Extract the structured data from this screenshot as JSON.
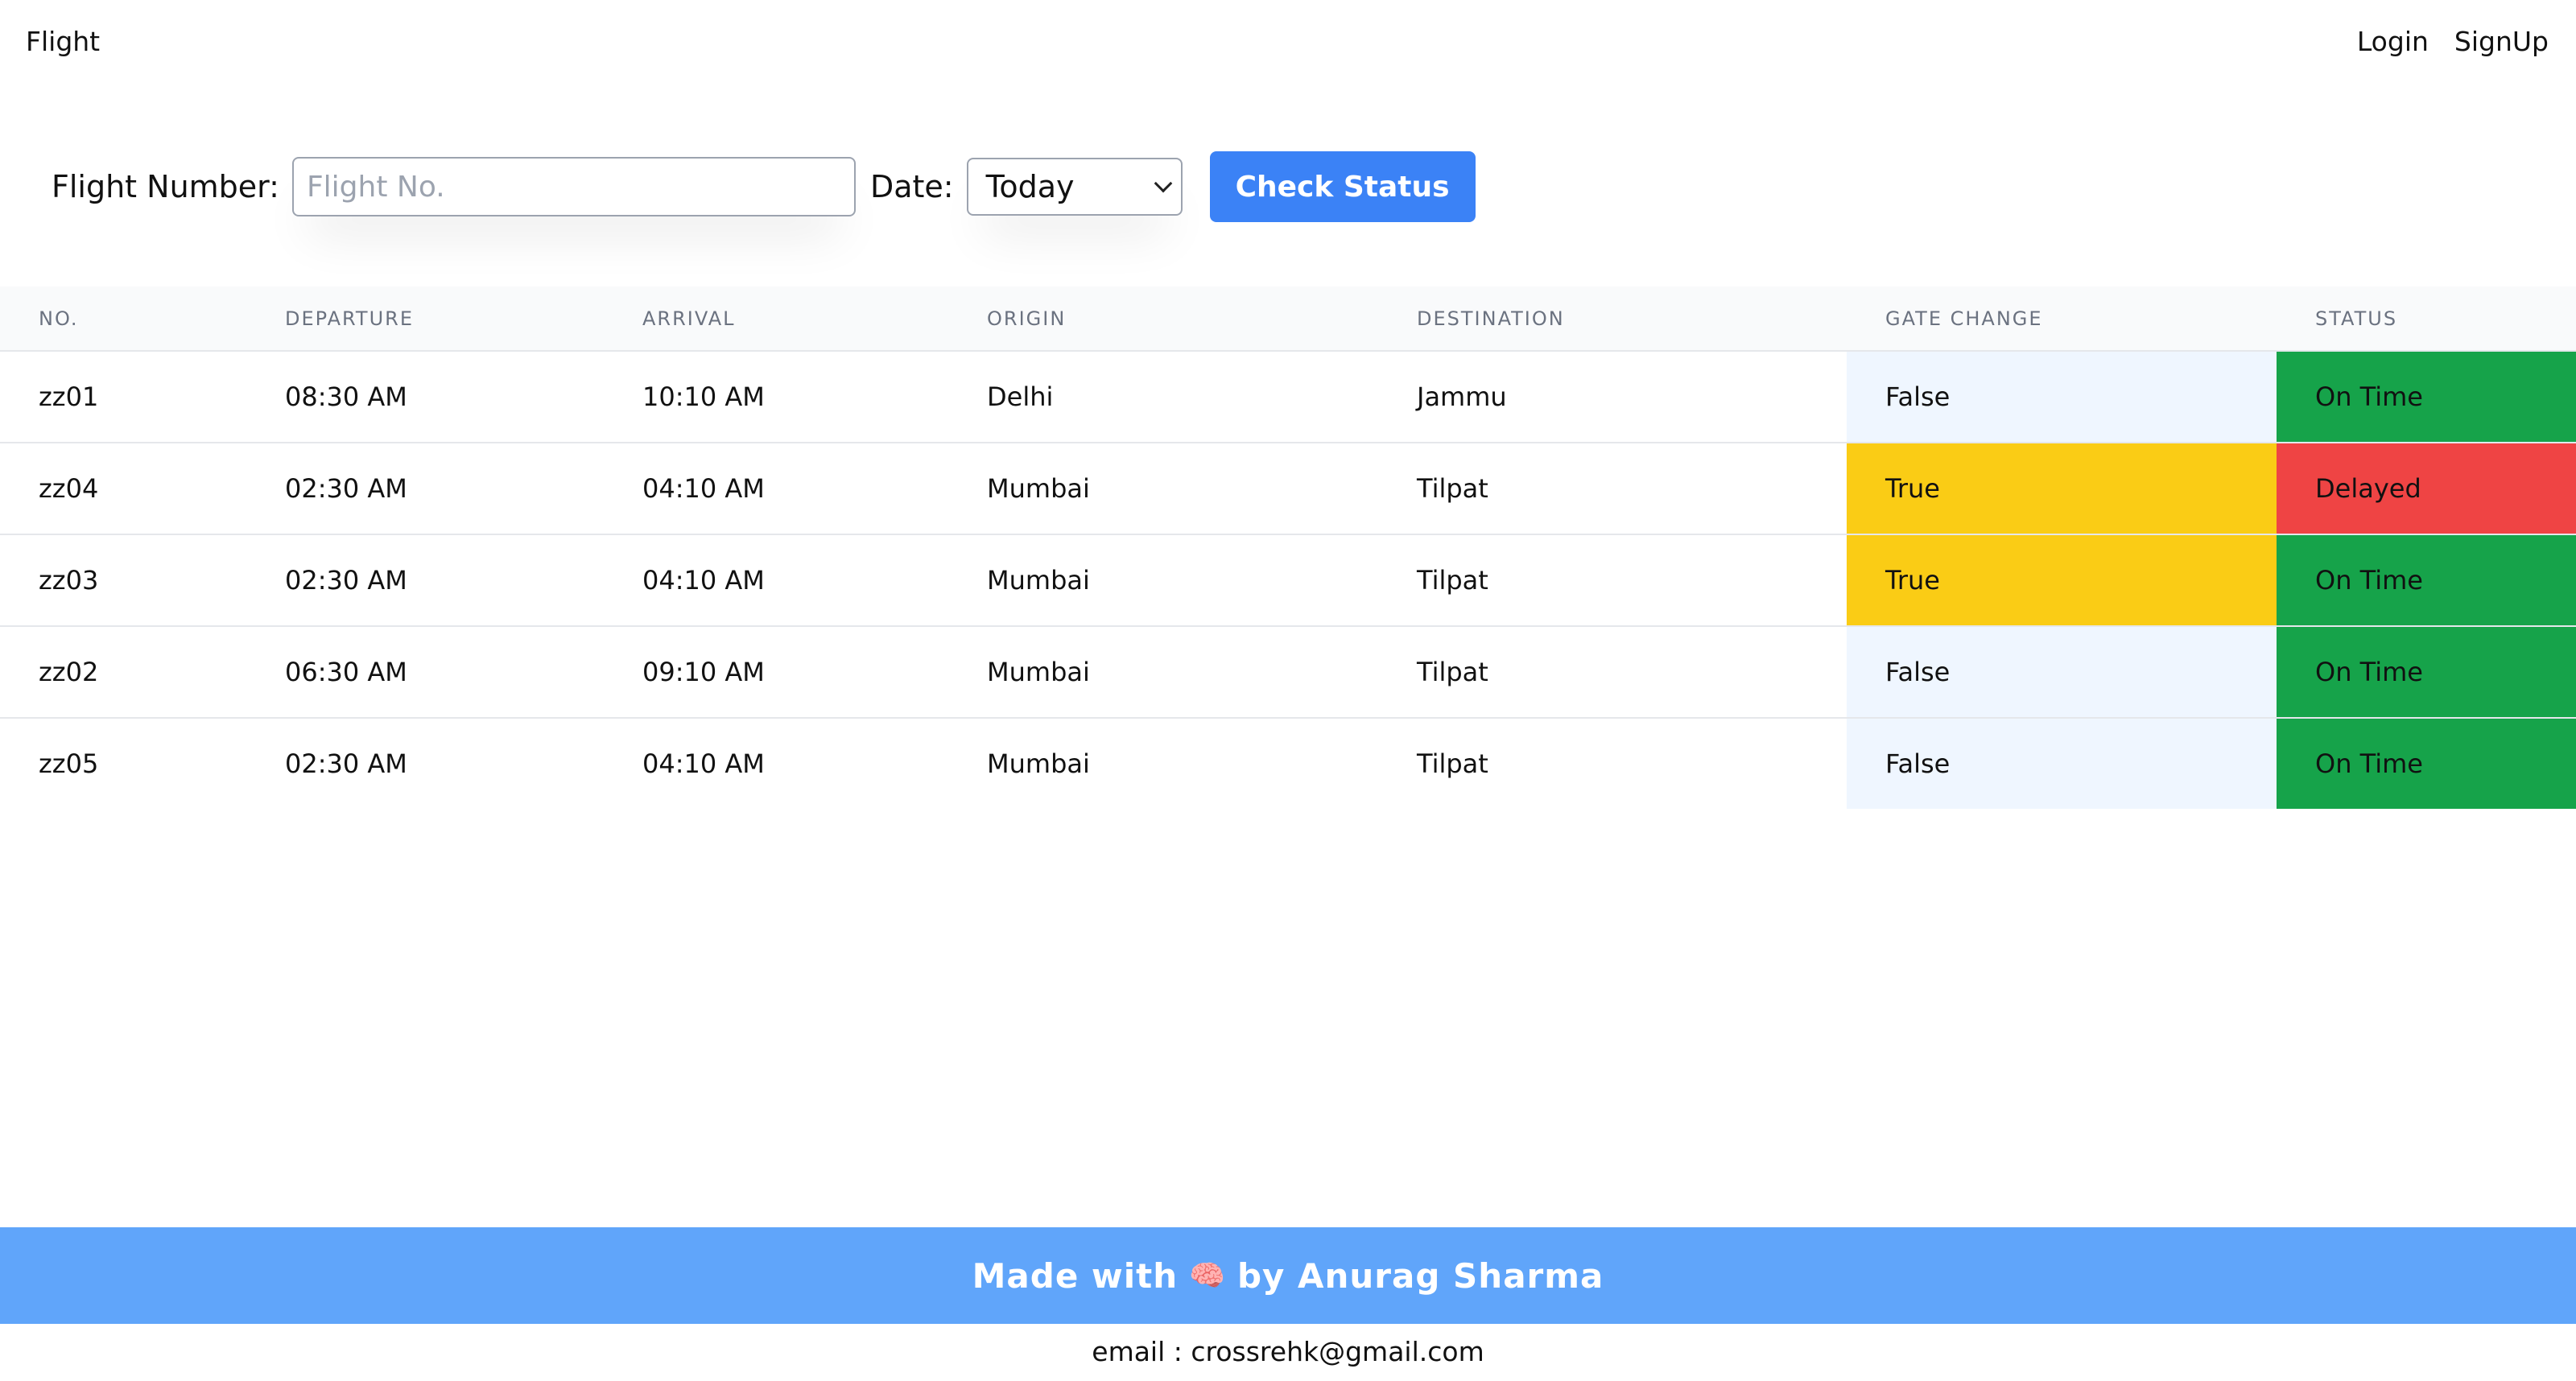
{
  "nav": {
    "brand": "Flight",
    "login": "Login",
    "signup": "SignUp"
  },
  "search": {
    "flight_label": "Flight Number:",
    "flight_placeholder": "Flight No.",
    "flight_value": "",
    "date_label": "Date:",
    "date_selected": "Today",
    "check_button": "Check Status"
  },
  "table": {
    "headers": {
      "no": "NO.",
      "departure": "DEPARTURE",
      "arrival": "ARRIVAL",
      "origin": "ORIGIN",
      "destination": "DESTINATION",
      "gate_change": "GATE CHANGE",
      "status": "STATUS"
    },
    "rows": [
      {
        "no": "zz01",
        "departure": "08:30 AM",
        "arrival": "10:10 AM",
        "origin": "Delhi",
        "destination": "Jammu",
        "gate_change": "False",
        "status": "On Time"
      },
      {
        "no": "zz04",
        "departure": "02:30 AM",
        "arrival": "04:10 AM",
        "origin": "Mumbai",
        "destination": "Tilpat",
        "gate_change": "True",
        "status": "Delayed"
      },
      {
        "no": "zz03",
        "departure": "02:30 AM",
        "arrival": "04:10 AM",
        "origin": "Mumbai",
        "destination": "Tilpat",
        "gate_change": "True",
        "status": "On Time"
      },
      {
        "no": "zz02",
        "departure": "06:30 AM",
        "arrival": "09:10 AM",
        "origin": "Mumbai",
        "destination": "Tilpat",
        "gate_change": "False",
        "status": "On Time"
      },
      {
        "no": "zz05",
        "departure": "02:30 AM",
        "arrival": "04:10 AM",
        "origin": "Mumbai",
        "destination": "Tilpat",
        "gate_change": "False",
        "status": "On Time"
      }
    ]
  },
  "colors": {
    "accent_button": "#3b82f6",
    "footer_bar": "#60a5fa",
    "gate_true": "#facc15",
    "gate_false": "#eff6ff",
    "status_on_time": "#16a34a",
    "status_delayed": "#ef4444"
  },
  "footer": {
    "made_with": "Made with",
    "brain_icon": "🧠",
    "by_author": "by Anurag Sharma",
    "email_line": "email : crossrehk@gmail.com"
  }
}
